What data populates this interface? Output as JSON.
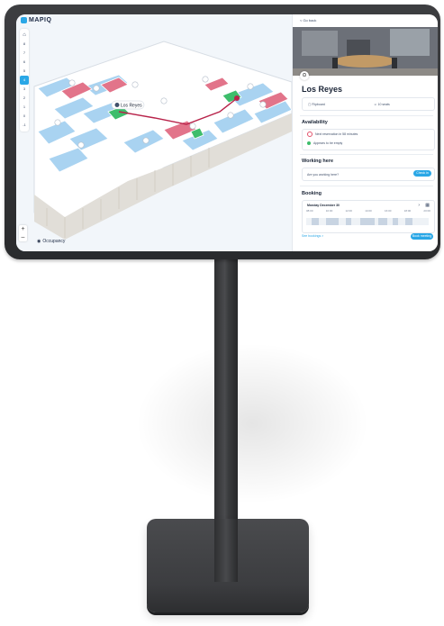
{
  "app": {
    "brand": "MAPIQ"
  },
  "map": {
    "floors": [
      "8",
      "7",
      "6",
      "5",
      "4",
      "3",
      "2",
      "1",
      "0",
      "-1"
    ],
    "active_floor": "4",
    "home_icon": "home-icon",
    "room_pin_label": "Los Reyes",
    "zoom_in": "+",
    "zoom_out": "–",
    "legend": "Occupancy"
  },
  "panel": {
    "back": "< Go back",
    "room_name": "Los Reyes",
    "spec_left": "Flipboard",
    "spec_right": "10 seats",
    "availability": {
      "heading": "Availability",
      "rows": [
        {
          "text": "Next reservation in 58 minutes",
          "color": "#e2506a"
        },
        {
          "text": "Appears to be empty",
          "color": "#3dbd6b"
        }
      ]
    },
    "working_here": {
      "heading": "Working here",
      "question": "Are you working here?",
      "button": "Check in"
    },
    "booking": {
      "heading": "Booking",
      "date": "Monday December 30",
      "times": [
        "08:00",
        "10:00",
        "12:00",
        "14:00",
        "16:00",
        "18:00",
        "20:00"
      ],
      "book_button": "Book meeting",
      "link": "See bookings >"
    }
  },
  "colors": {
    "accent": "#2aa7e6",
    "occupied": "#e2506a",
    "free": "#3dbd6b",
    "room": "#a9d3f1"
  }
}
